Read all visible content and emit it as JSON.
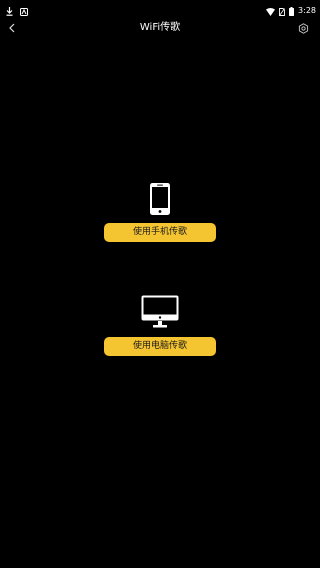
{
  "status_bar": {
    "time": "3:28",
    "left_icons": [
      "download-icon",
      "notification-icon"
    ],
    "right_icons": [
      "wifi-icon",
      "no-sim-icon",
      "battery-icon"
    ]
  },
  "header": {
    "title": "WiFi传歌",
    "back_icon": "chevron-left-icon",
    "settings_icon": "gear-icon"
  },
  "main": {
    "phone_transfer": {
      "icon": "smartphone-icon",
      "label": "使用手机传歌"
    },
    "pc_transfer": {
      "icon": "monitor-icon",
      "label": "使用电脑传歌"
    }
  },
  "colors": {
    "background": "#000000",
    "button_accent": "#f5c531",
    "button_text": "#1a1a1a",
    "foreground": "#ffffff"
  }
}
